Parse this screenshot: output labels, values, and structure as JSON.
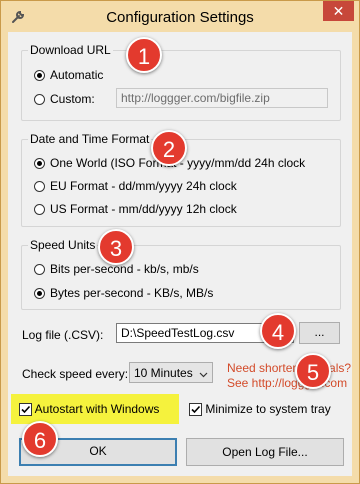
{
  "window": {
    "title": "Configuration Settings",
    "close_glyph": "✕"
  },
  "download": {
    "legend": "Download URL",
    "options": [
      "Automatic",
      "Custom:"
    ],
    "selected": 0,
    "custom_url": "http://loggger.com/bigfile.zip"
  },
  "datetime": {
    "legend": "Date and Time Format",
    "options": [
      "One World (ISO Format - yyyy/mm/dd 24h clock",
      "EU Format - dd/mm/yyyy 24h clock",
      "US Format - mm/dd/yyyy 12h clock"
    ],
    "selected": 0
  },
  "speed": {
    "legend": "Speed Units",
    "options": [
      "Bits per-second - kb/s, mb/s",
      "Bytes per-second - KB/s, MB/s"
    ],
    "selected": 1
  },
  "logfile": {
    "label": "Log file (.CSV):",
    "value": "D:\\SpeedTestLog.csv",
    "browse_label": "..."
  },
  "check": {
    "label": "Check speed every:",
    "selected": "10 Minutes"
  },
  "hint": {
    "line1": "Need shorter intervals?",
    "line2": "See http://loggger.com"
  },
  "options": {
    "autostart_label": "Autostart with Windows",
    "autostart_checked": true,
    "minimize_label": "Minimize to system tray",
    "minimize_checked": true
  },
  "buttons": {
    "ok": "OK",
    "open_log": "Open Log File..."
  },
  "badges": [
    "1",
    "2",
    "3",
    "4",
    "5",
    "6"
  ],
  "colors": {
    "badge": "#e33a2e",
    "highlight": "#f5f23d",
    "frame": "#f4dcaa",
    "link": "#d34b2a"
  }
}
